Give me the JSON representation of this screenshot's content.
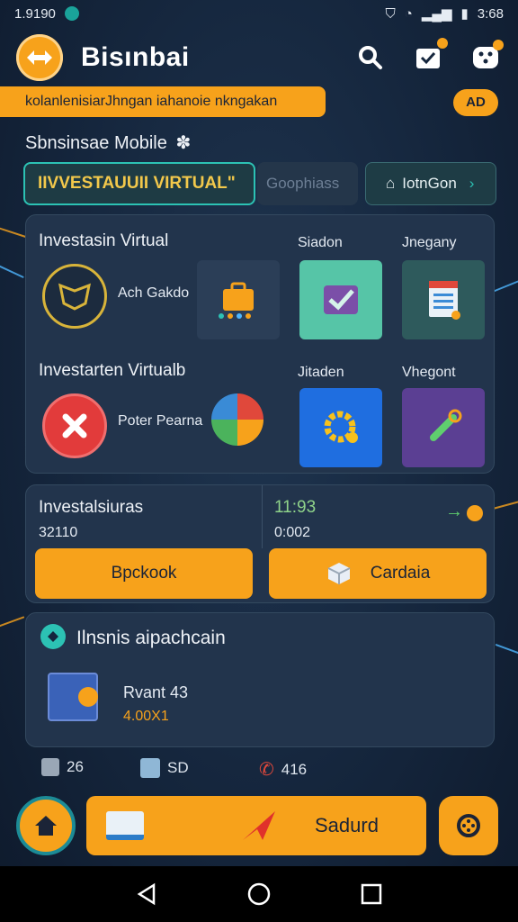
{
  "status_bar": {
    "time_left": "1.9190",
    "time_right": "3:68"
  },
  "header": {
    "title": "Bisınbai"
  },
  "banner": {
    "text": "kolanlenisiarJhngan iahanoie nkngakan",
    "ad_label": "AD"
  },
  "section": {
    "title": "Sbnsinsae Mobile"
  },
  "tabs": [
    {
      "label": "IIVVESTAUUII VIRTUAL\""
    },
    {
      "label": "Goophiass"
    },
    {
      "label": "IotnGon"
    }
  ],
  "grid": {
    "row1": {
      "title": "Investasin Virtual",
      "item_label": "Ach Gakdo",
      "col2_label": "Siadon",
      "col3_label": "Jnegany"
    },
    "row2": {
      "title": "Investarten Virtualb",
      "item_label": "Poter Pearna",
      "col2_label": "Jitaden",
      "col3_label": "Vhegont"
    }
  },
  "balance": {
    "left": {
      "title": "Investalsiuras",
      "value": "32110",
      "button": "Bpckook"
    },
    "right": {
      "title": "11:93",
      "value": "0:002",
      "button": "Cardaia"
    }
  },
  "investment": {
    "title": "Ilnsnis aipachcain",
    "item_name": "Rvant 43",
    "item_value": "4.00X1"
  },
  "stats": [
    {
      "value": "26"
    },
    {
      "value": "SD"
    },
    {
      "value": "416"
    }
  ],
  "bottom": {
    "main_action": "Sadurd"
  },
  "colors": {
    "accent": "#f7a21b",
    "teal": "#2cc2b4",
    "background": "#15263d"
  }
}
